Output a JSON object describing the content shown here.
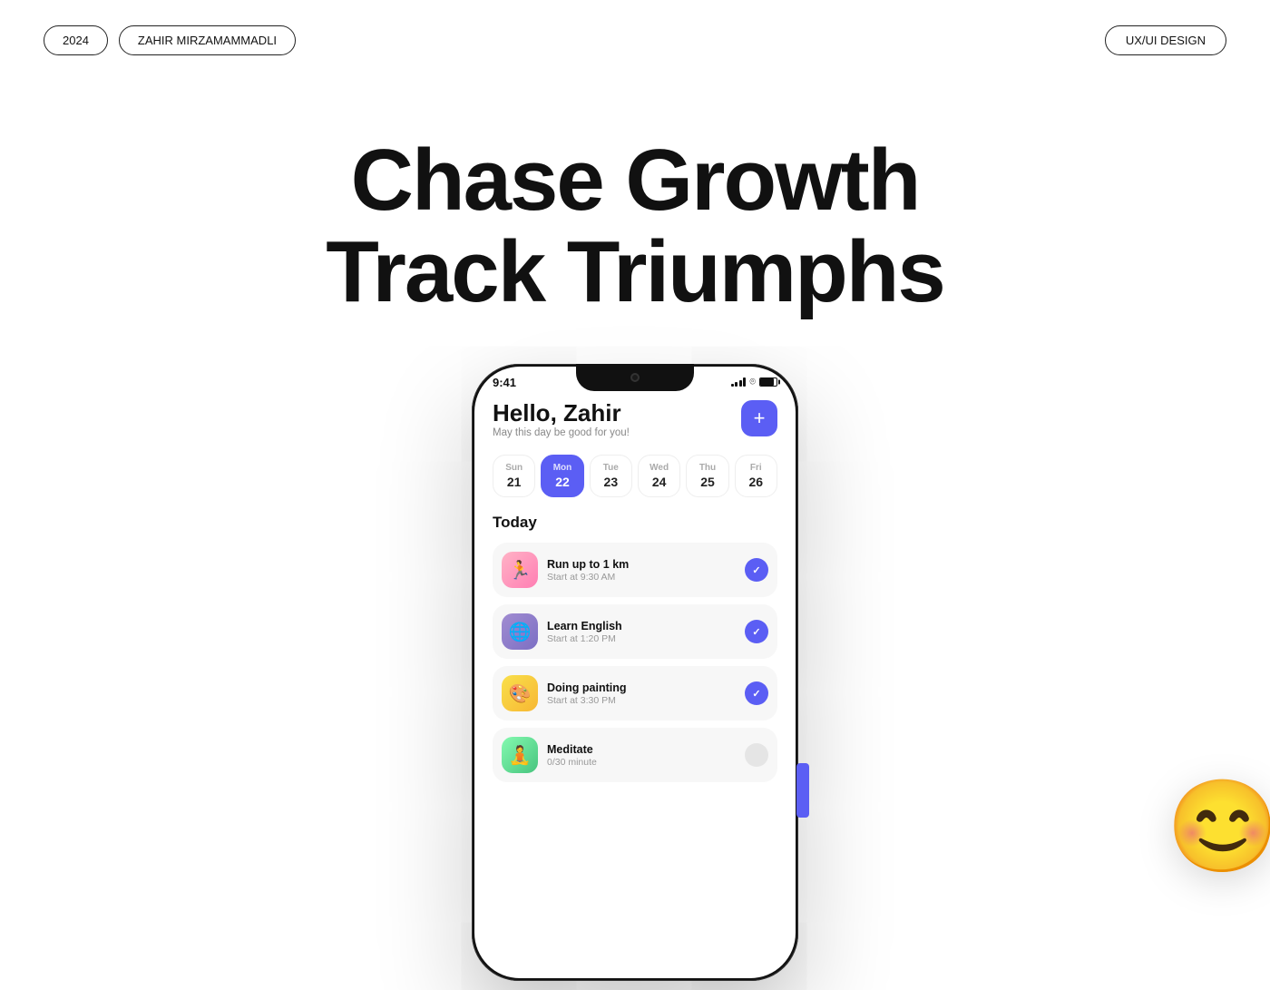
{
  "header": {
    "year": "2024",
    "author": "ZAHIR MIRZAMAMMADLI",
    "category": "UX/UI DESIGN"
  },
  "hero": {
    "line1": "Chase Growth",
    "line2": "Track Triumphs"
  },
  "phone": {
    "status_time": "9:41",
    "greeting": "Hello, Zahir",
    "greeting_sub": "May this day be good for you!",
    "add_button": "+",
    "today_label": "Today",
    "days": [
      {
        "name": "Sun",
        "num": "21",
        "active": false
      },
      {
        "name": "Mon",
        "num": "22",
        "active": true
      },
      {
        "name": "Tue",
        "num": "23",
        "active": false
      },
      {
        "name": "Wed",
        "num": "24",
        "active": false
      },
      {
        "name": "Thu",
        "num": "25",
        "active": false
      },
      {
        "name": "Fri",
        "num": "26",
        "active": false
      }
    ],
    "habits": [
      {
        "name": "Run up to 1 km",
        "time": "Start at 9:30 AM",
        "checked": true,
        "icon": "🏃",
        "color": "pink"
      },
      {
        "name": "Learn English",
        "time": "Start at 1:20 PM",
        "checked": true,
        "icon": "🌐",
        "color": "purple"
      },
      {
        "name": "Doing painting",
        "time": "Start at 3:30 PM",
        "checked": true,
        "icon": "🎨",
        "color": "yellow"
      },
      {
        "name": "Meditate",
        "time": "0/30 minute",
        "checked": false,
        "icon": "🧘",
        "color": "green"
      }
    ]
  }
}
